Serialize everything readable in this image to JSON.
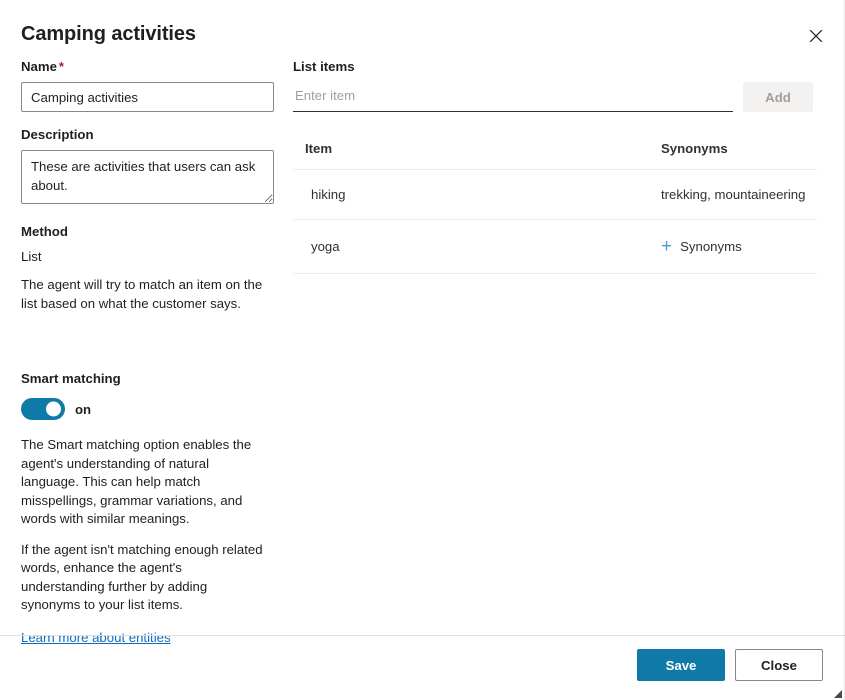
{
  "dialog": {
    "title": "Camping activities",
    "close_icon": "close-icon"
  },
  "form": {
    "name": {
      "label": "Name",
      "required_marker": "*",
      "value": "Camping activities",
      "placeholder": ""
    },
    "description": {
      "label": "Description",
      "value": "These are activities that users can ask about.",
      "placeholder": ""
    },
    "method": {
      "label": "Method",
      "value": "List",
      "help": "The agent will try to match an item on the list based on what the customer says."
    }
  },
  "smart_matching": {
    "label": "Smart matching",
    "toggle_state": "on",
    "toggle_on": true,
    "paragraph_1": "The Smart matching option enables the agent's understanding of natural language. This can help match misspellings, grammar variations, and words with similar meanings.",
    "paragraph_2": "If the agent isn't matching enough related words, enhance the agent's understanding further by adding synonyms to your list items.",
    "link_text": "Learn more about entities"
  },
  "list_items": {
    "label": "List items",
    "input_value": "",
    "input_placeholder": "Enter item",
    "add_button": "Add",
    "add_button_disabled": true,
    "columns": [
      "Item",
      "Synonyms"
    ],
    "rows": [
      {
        "item": "hiking",
        "synonyms": "trekking, mountaineering",
        "has_synonyms": true,
        "add_label": ""
      },
      {
        "item": "yoga",
        "synonyms": "",
        "has_synonyms": false,
        "add_label": "Synonyms"
      }
    ]
  },
  "footer": {
    "save_label": "Save",
    "close_label": "Close"
  },
  "colors": {
    "accent": "#0f7aa8",
    "link": "#0f6cbd",
    "required": "#a4262c",
    "plus": "#4a9fd0",
    "divider": "#edebe9"
  }
}
